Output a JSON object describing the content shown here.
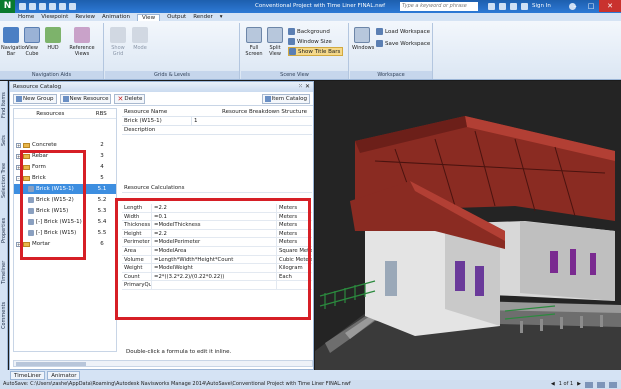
{
  "window": {
    "title": "Conventional Project with Time Liner FINAL.nwf",
    "search_placeholder": "Type a keyword or phrase",
    "sign_in": "Sign In"
  },
  "ribbon": {
    "tabs": [
      "Home",
      "Viewpoint",
      "Review",
      "Animation",
      "View",
      "Output",
      "Render"
    ],
    "active_tab": "View",
    "groups": {
      "navigation_aids": "Navigation Aids",
      "grids_levels": "Grids & Levels",
      "scene_view": "Scene View",
      "workspace": "Workspace"
    },
    "buttons": {
      "navigation_bar": "Navigation Bar",
      "view_cube": "View Cube",
      "hud": "HUD",
      "reference_views": "Reference Views",
      "show_grid": "Show Grid",
      "mode": "Mode",
      "full_screen": "Full Screen",
      "split_view": "Split View",
      "background": "Background",
      "window_size": "Window Size",
      "show_title_bars": "Show Title Bars",
      "windows": "Windows",
      "load_workspace": "Load Workspace",
      "save_workspace": "Save Workspace"
    }
  },
  "left_strip": [
    "Find Items",
    "Sets",
    "Selection Tree",
    "Properties",
    "Timeliner",
    "Comments"
  ],
  "resource_panel": {
    "title": "Resource Catalog",
    "toolbar": {
      "new_group": "New Group",
      "new_resource": "New Resource",
      "delete": "Delete",
      "item_catalog": "Item Catalog"
    },
    "tree_headers": {
      "resources": "Resources",
      "rbs": "RBS"
    },
    "tree": [
      {
        "name": "Concrete",
        "rbs": "2",
        "level": 0
      },
      {
        "name": "Rebar",
        "rbs": "3",
        "level": 0
      },
      {
        "name": "Form",
        "rbs": "4",
        "level": 0
      },
      {
        "name": "Brick",
        "rbs": "5",
        "level": 0
      },
      {
        "name": "Brick (W15-1)",
        "rbs": "5.1",
        "level": 1,
        "selected": true
      },
      {
        "name": "Brick (W15-2)",
        "rbs": "5.2",
        "level": 1
      },
      {
        "name": "Brick (W15)",
        "rbs": "5.3",
        "level": 1
      },
      {
        "name": "[-] Brick (W15-1)",
        "rbs": "5.4",
        "level": 1
      },
      {
        "name": "[-] Brick (W15)",
        "rbs": "5.5",
        "level": 1
      },
      {
        "name": "Mortar",
        "rbs": "6",
        "level": 0
      }
    ],
    "details": {
      "resource_name_label": "Resource Name",
      "rbs_label": "Resource Breakdown Structure",
      "resource_name_value": "Brick (W15-1)",
      "rbs_value": "1",
      "description_label": "Description",
      "calculations_label": "Resource Calculations"
    },
    "calculations": [
      {
        "name": "Length",
        "formula": "=2.2",
        "unit": "Meters"
      },
      {
        "name": "Width",
        "formula": "=0.1",
        "unit": "Meters"
      },
      {
        "name": "Thickness",
        "formula": "=ModelThickness",
        "unit": "Meters"
      },
      {
        "name": "Height",
        "formula": "=2.2",
        "unit": "Meters"
      },
      {
        "name": "Perimeter",
        "formula": "=ModelPerimeter",
        "unit": "Meters"
      },
      {
        "name": "Area",
        "formula": "=ModelArea",
        "unit": "Square Meters"
      },
      {
        "name": "Volume",
        "formula": "=Length*Width*Height*Count",
        "unit": "Cubic Meters"
      },
      {
        "name": "Weight",
        "formula": "=ModelWeight",
        "unit": "Kilogram"
      },
      {
        "name": "Count",
        "formula": "=2*((3.2*2.2)/(0.22*0.22))",
        "unit": "Each"
      },
      {
        "name": "PrimaryQuantity",
        "formula": "",
        "unit": ""
      }
    ],
    "hint": "Double-click a formula to edit it inline."
  },
  "bottom_tabs": [
    "TimeLiner",
    "Animator"
  ],
  "status": {
    "path": "AutoSave: C:\\Users\\zashe\\AppData\\Roaming\\Autodesk Navisworks Manage 2014\\AutoSave\\Conventional Project with Time Liner FINAL.nwf",
    "page": "1 of 1"
  },
  "colors": {
    "title_bar": "#1d5fae",
    "highlight_box": "#d61f26",
    "selection": "#3d8ee0",
    "roof": "#8a2b22"
  }
}
